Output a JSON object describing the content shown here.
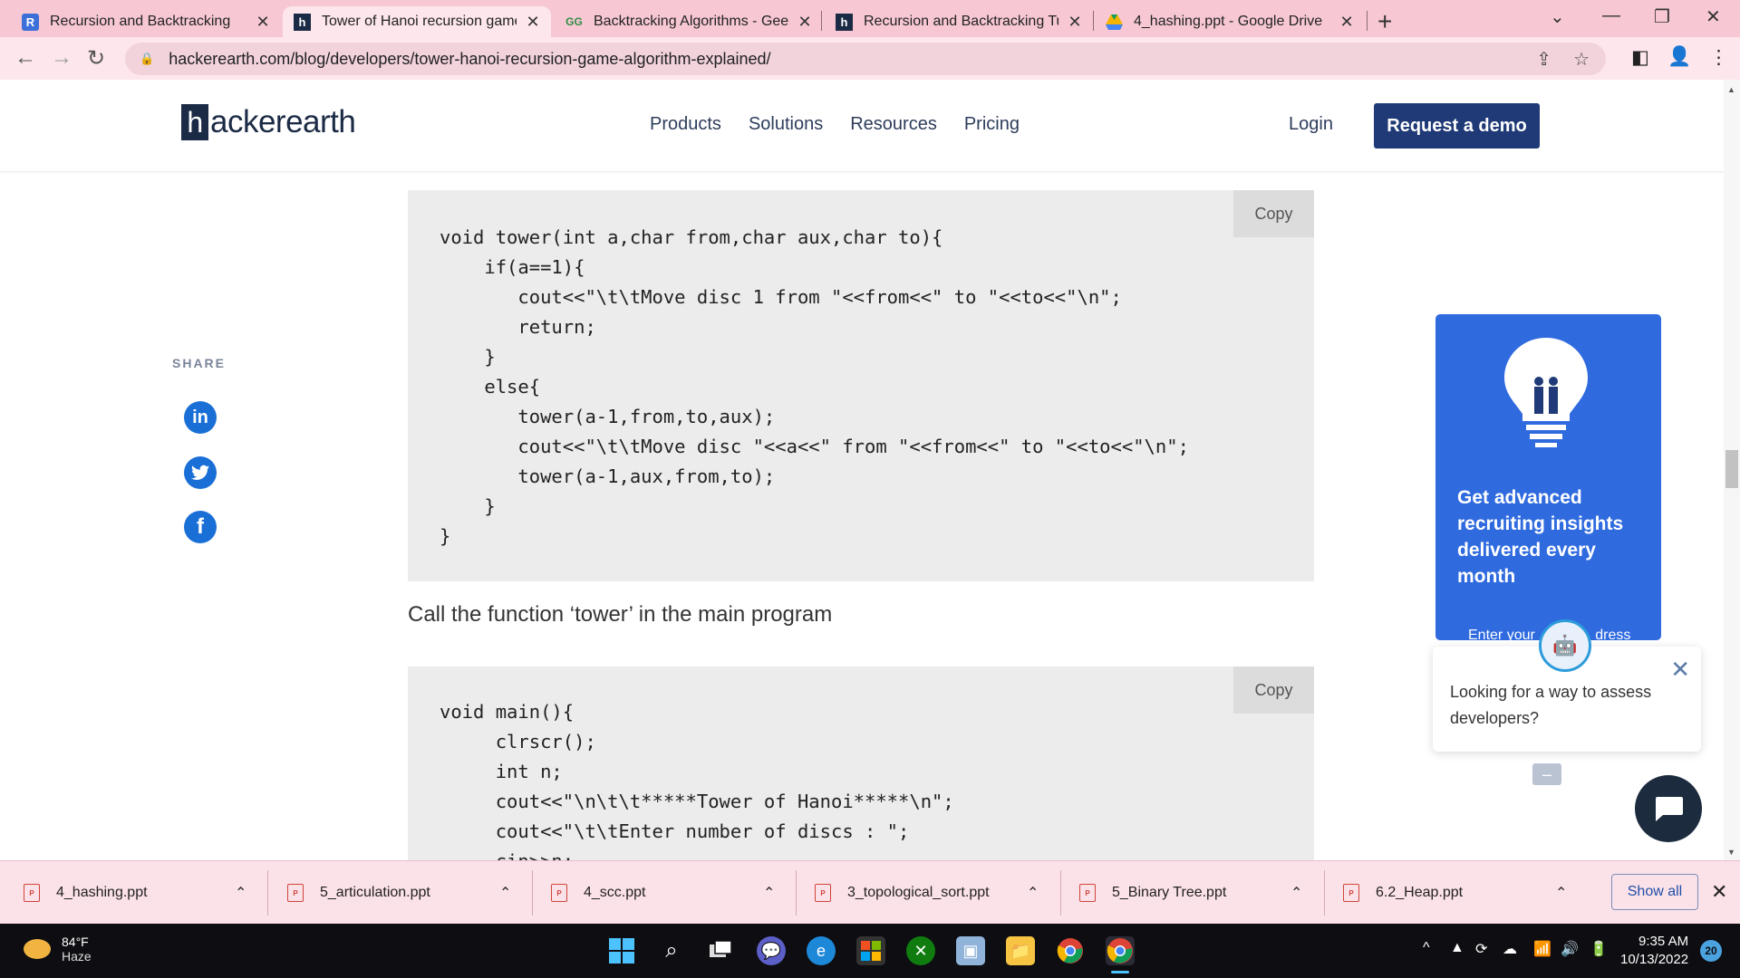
{
  "browser": {
    "tabs": [
      {
        "title": "Recursion and Backtracking",
        "favicon": "R"
      },
      {
        "title": "Tower of Hanoi recursion game a",
        "favicon": "h"
      },
      {
        "title": "Backtracking Algorithms - Geeks",
        "favicon": "G"
      },
      {
        "title": "Recursion and Backtracking Tuto",
        "favicon": "h"
      },
      {
        "title": "4_hashing.ppt - Google Drive",
        "favicon": "D"
      }
    ],
    "url": "hackerearth.com/blog/developers/tower-hanoi-recursion-game-algorithm-explained/"
  },
  "site": {
    "logo_letter": "h",
    "logo_rest": "ackerearth",
    "nav": [
      "Products",
      "Solutions",
      "Resources",
      "Pricing"
    ],
    "login": "Login",
    "cta": "Request a demo"
  },
  "share": {
    "label": "SHARE",
    "icons": [
      {
        "name": "linkedin-icon",
        "glyph": "in",
        "color": "#1a6fd6"
      },
      {
        "name": "twitter-icon",
        "glyph": "🐦",
        "color": "#1a6fd6"
      },
      {
        "name": "facebook-icon",
        "glyph": "f",
        "color": "#1a6fd6"
      }
    ]
  },
  "code1": {
    "copy": "Copy",
    "lines": [
      "void tower(int a,char from,char aux,char to){",
      "    if(a==1){",
      "       cout<<\"\\t\\tMove disc 1 from \"<<from<<\" to \"<<to<<\"\\n\";",
      "       return;",
      "    }",
      "    else{",
      "       tower(a-1,from,to,aux);",
      "       cout<<\"\\t\\tMove disc \"<<a<<\" from \"<<from<<\" to \"<<to<<\"\\n\";",
      "       tower(a-1,aux,from,to);",
      "    }",
      "}"
    ]
  },
  "paragraph": "Call the function ‘tower’ in the main program",
  "code2": {
    "copy": "Copy",
    "lines": [
      "void main(){",
      "     clrscr();",
      "     int n;",
      "     cout<<\"\\n\\t\\t*****Tower of Hanoi*****\\n\";",
      "     cout<<\"\\t\\tEnter number of discs : \";",
      "     cin>>n;"
    ]
  },
  "promo": {
    "text": "Get advanced recruiting insights delivered every month",
    "input_hint_start": "Enter your ",
    "input_hint_end": "dress"
  },
  "chat": {
    "message": "Looking for a way to assess developers?"
  },
  "downloads": {
    "files": [
      "4_hashing.ppt",
      "5_articulation.ppt",
      "4_scc.ppt",
      "3_topological_sort.ppt",
      "5_Binary Tree.ppt",
      "6.2_Heap.ppt"
    ],
    "show_all": "Show all"
  },
  "taskbar": {
    "temp": "84°F",
    "condition": "Haze",
    "time": "9:35 AM",
    "date": "10/13/2022",
    "notifications": "20"
  }
}
